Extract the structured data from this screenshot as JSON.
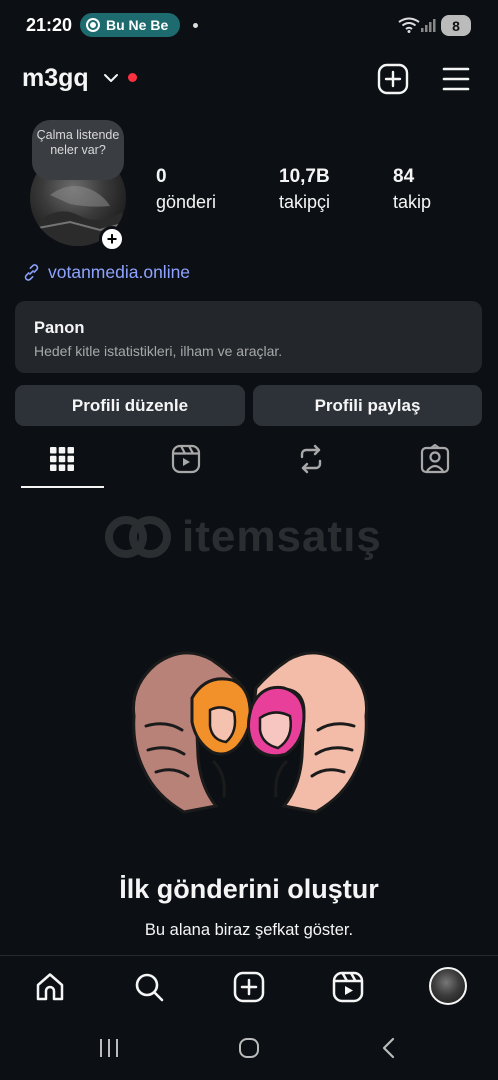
{
  "status_bar": {
    "time": "21:20",
    "notification_pill": "Bu Ne Be",
    "battery": "8"
  },
  "header": {
    "username": "m3gq"
  },
  "profile": {
    "note_bubble": "Çalma listende neler var?",
    "stats": [
      {
        "value": "0",
        "label": "gönderi"
      },
      {
        "value": "10,7B",
        "label": "takipçi"
      },
      {
        "value": "84",
        "label": "takip"
      }
    ],
    "link": "votanmedia.online"
  },
  "dashboard": {
    "title": "Panon",
    "subtitle": "Hedef kitle istatistikleri, ilham ve araçlar."
  },
  "actions": {
    "edit_profile": "Profili düzenle",
    "share_profile": "Profili paylaş"
  },
  "tabs": [
    {
      "icon": "grid-icon",
      "active": true
    },
    {
      "icon": "reels-icon",
      "active": false
    },
    {
      "icon": "repost-icon",
      "active": false
    },
    {
      "icon": "tagged-icon",
      "active": false
    }
  ],
  "watermark": {
    "text": "itemsatış"
  },
  "empty_state": {
    "title": "İlk gönderini oluştur",
    "subtitle": "Bu alana biraz şefkat göster."
  },
  "bottom_nav": [
    "home-icon",
    "search-icon",
    "create-icon",
    "reels-icon",
    "profile-avatar"
  ],
  "colors": {
    "background": "#0c1014",
    "card": "#23272c",
    "button": "#2d3238",
    "link": "#8ea3ff",
    "notification_dot": "#ff3040"
  }
}
